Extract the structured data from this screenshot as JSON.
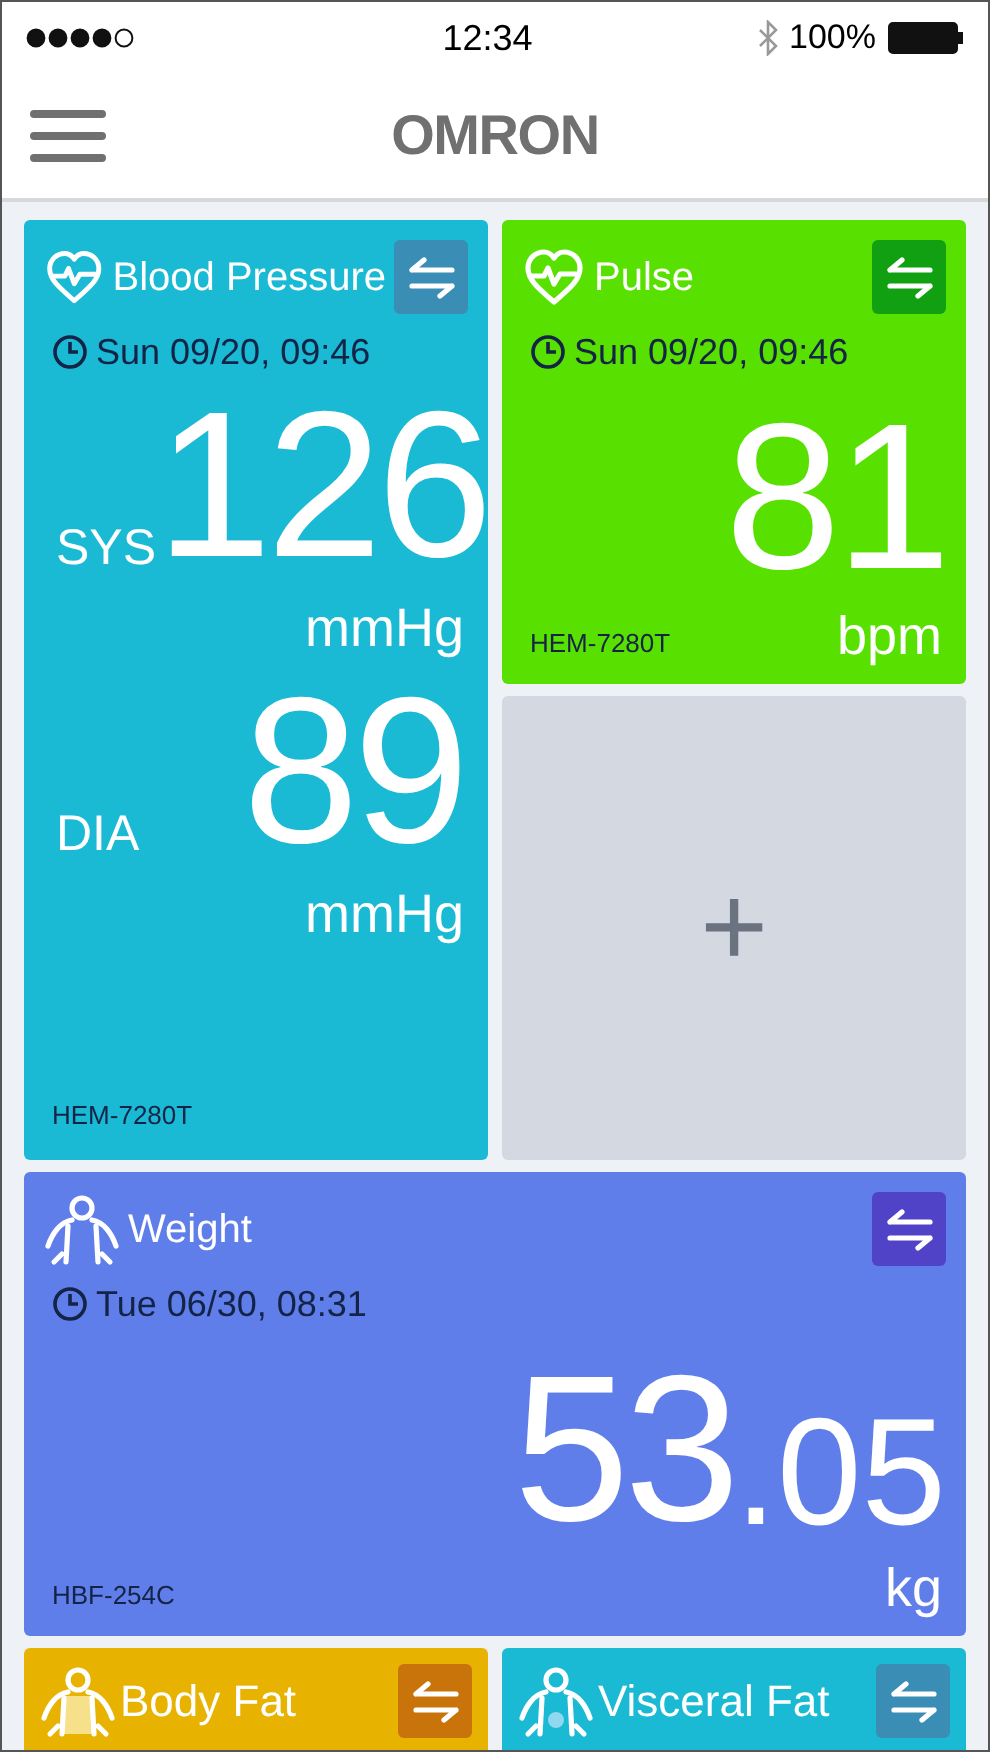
{
  "status_bar": {
    "time": "12:34",
    "battery": "100%"
  },
  "header": {
    "logo": "OMRON"
  },
  "tiles": [
    {
      "kind": "bp",
      "title": "Blood Pressure",
      "color": "#1ab9d4",
      "date": "Sun 09/20, 09:46",
      "readings": [
        {
          "label": "SYS",
          "value": "126",
          "unit": "mmHg"
        },
        {
          "label": "DIA",
          "value": "89",
          "unit": "mmHg"
        }
      ],
      "model": "HEM-7280T"
    },
    {
      "kind": "pulse",
      "title": "Pulse",
      "color": "#58e000",
      "date": "Sun 09/20, 09:46",
      "readings": [
        {
          "value": "81",
          "unit": "bpm"
        }
      ],
      "model": "HEM-7280T"
    },
    {
      "kind": "add",
      "symbol": "+"
    },
    {
      "kind": "weight",
      "title": "Weight",
      "color": "#5f7eea",
      "date": "Tue 06/30, 08:31",
      "readings": [
        {
          "value": "53",
          "decimal": ".05",
          "unit": "kg"
        }
      ],
      "model": "HBF-254C"
    },
    {
      "kind": "body-fat",
      "title": "Body Fat",
      "color": "#e7b200"
    },
    {
      "kind": "visceral-fat",
      "title": "Visceral Fat",
      "color": "#1ab9d4"
    }
  ]
}
